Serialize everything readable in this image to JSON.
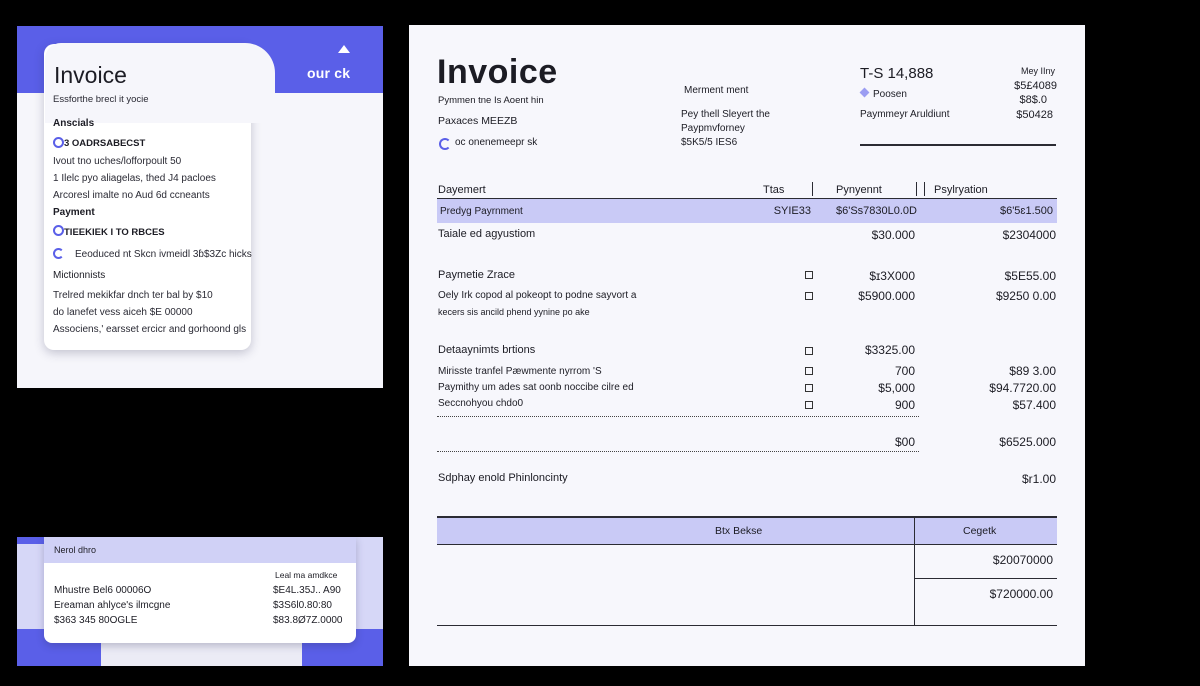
{
  "left_panel": {
    "top_link": "our ck",
    "title": "Invoice",
    "subtitle": "Essforthe brecl it yocie",
    "section1": "Anscials",
    "item1_strong": "3 OADRSABECST",
    "lines1": [
      "Ivout tno uches/lofforpoult 50",
      "1 Ilelc pyo aliagelas, thed J4 pacloes",
      "Arcoresl imalte no Aud 6d ccneants"
    ],
    "section2": "Payment",
    "item2_strong": "TIEEKIEK I TO RBCES",
    "item2_line": "Eeoduced nt Skcn ivmeidl 3ɓ$3Zc hicks",
    "section3": "Mictionnists",
    "lines3": [
      "Trelred mekikfar dnch ter bal by $10",
      "do lanefet vess aiceh $E 00000",
      "Associens,' earsset ercicr and gorhoond gls"
    ]
  },
  "bottom_left": {
    "header": "Nerol dhro",
    "col_header": "Leal ma amdkce",
    "rows": [
      {
        "label": "Mhustre Bel6 00006O",
        "value": "$E4L.35J.. A90"
      },
      {
        "label": "Ereaman ahlyce's ilmcgne",
        "value": "$3S6l0.80:80"
      },
      {
        "label": "$363 345 80OGLE",
        "value": "$83.8Ø7Z.0000"
      }
    ]
  },
  "invoice": {
    "title": "Invoice",
    "sub1": "Pymmen tne Is Aoent hin",
    "sub2": "Paxaces MEEZB",
    "sub3": "oc onenemeepr sk",
    "mid_label": "Merment ment",
    "mid_lines": [
      "Pey thell Sleyert the",
      "Paypmvforney",
      "$5K5/5 IES6"
    ],
    "total_label": "T-S 14,888",
    "right_small": "Mey IIny",
    "right_rows": [
      {
        "label": "Poosen",
        "value": "$5£4089"
      },
      {
        "label": "",
        "value": "$8$.0"
      },
      {
        "label": "Paymmeyr Aruldiunt",
        "value": "$50428"
      }
    ],
    "table_head": {
      "c1": "Dayemert",
      "c2": "Ttas",
      "c3": "Pynyennt",
      "c4": "Psylryation"
    },
    "highlight_row": {
      "label": "Predyg Payrnment",
      "c2": "SYIE33",
      "c3": "$6'Ss7830L0.0D",
      "c4": "$6'5ɛ1.500"
    },
    "row2": {
      "label": "Taiale ed agyustiom",
      "c3": "$30.000",
      "c4": "$2304000"
    },
    "group1": {
      "title": "Paymetie Zrace",
      "title_c3": "$ɪ3X000",
      "title_c4": "$5E55.00",
      "line1": "Oely Irk copod al pokeopt to podne sayvort a",
      "line1_c3": "$5900.000",
      "line1_c4": "$9250 0.00",
      "line2": "kecers sis ancild phend yynine po ake"
    },
    "group2": {
      "title": "Detaaynimts brtions",
      "title_c3": "$3325.00",
      "lines": [
        {
          "label": "Mirisste tranfel Pæwmente nyrrom 'S",
          "c3": "700",
          "c4": "$89 3.00"
        },
        {
          "label": "Paymithy um ades sat oonb noccibe cilre ed",
          "c3": "$5,000",
          "c4": "$94.7720.00"
        },
        {
          "label": "Seccnohyou chdo0",
          "c3": "900",
          "c4": "$57.400"
        }
      ]
    },
    "subtotal": {
      "c3": "$00",
      "c4": "$6525.000"
    },
    "shipping": {
      "label": "Sdphay enold Phinloncinty",
      "value": "$r1.00"
    },
    "bottom": {
      "head_left": "Btx Bekse",
      "head_right": "Cegetk",
      "v1": "$20070000",
      "v2": "$720000.00"
    }
  }
}
